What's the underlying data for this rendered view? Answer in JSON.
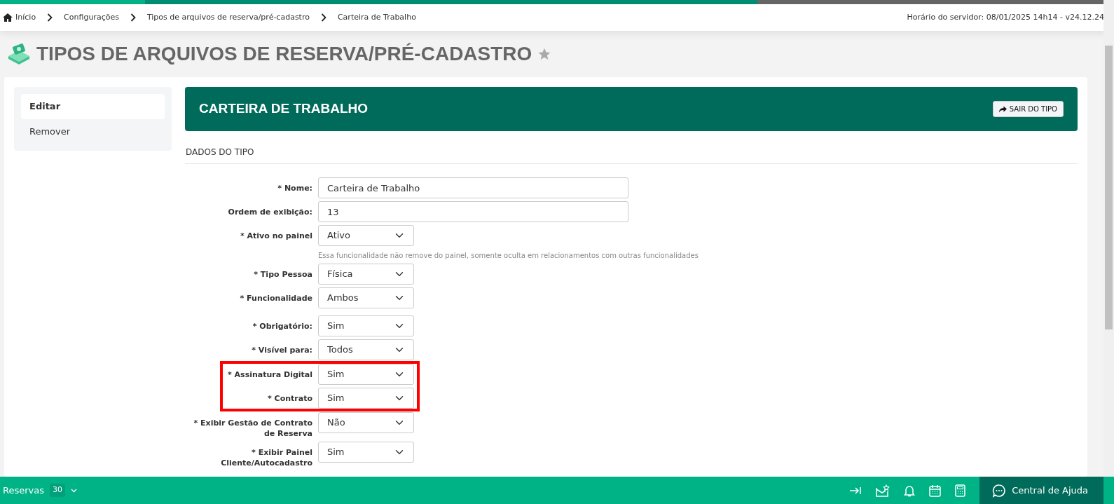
{
  "breadcrumb": [
    {
      "label": "Início",
      "kind": "home"
    },
    {
      "label": "Configurações",
      "kind": "link"
    },
    {
      "label": "Tipos de arquivos de reserva/pré-cadastro",
      "kind": "link"
    },
    {
      "label": "Carteira de Trabalho",
      "kind": "current"
    }
  ],
  "server_time": "Horário do servidor: 08/01/2025 14h14 - v24.12.24",
  "page_title": "TIPOS DE ARQUIVOS DE RESERVA/PRÉ-CADASTRO",
  "sidebar": {
    "items": [
      {
        "label": "Editar",
        "selected": true
      },
      {
        "label": "Remover",
        "selected": false
      }
    ]
  },
  "header": {
    "title": "CARTEIRA DE TRABALHO",
    "button": "SAIR DO TIPO"
  },
  "section_title": "DADOS DO TIPO",
  "fields": [
    {
      "label": "* Nome:",
      "kind": "text",
      "value": "Carteira de Trabalho",
      "highlighted": false
    },
    {
      "label": "Ordem de exibição:",
      "kind": "text",
      "value": "13",
      "highlighted": false
    },
    {
      "label": "* Ativo no painel",
      "kind": "select",
      "value": "Ativo",
      "hint": "Essa funcionalidade não remove do painel, somente oculta em relacionamentos com outras funcionalidades",
      "highlighted": false
    },
    {
      "label": "* Tipo Pessoa",
      "kind": "select",
      "value": "Física",
      "highlighted": false
    },
    {
      "label": "* Funcionalidade",
      "kind": "select",
      "value": "Ambos",
      "highlighted": false
    },
    {
      "label": "* Obrigatório:",
      "kind": "select",
      "value": "Sim",
      "highlighted": false
    },
    {
      "label": "* Visível para:",
      "kind": "select",
      "value": "Todos",
      "highlighted": false
    },
    {
      "label": "* Assinatura Digital",
      "kind": "select",
      "value": "Sim",
      "highlighted": true
    },
    {
      "label": "* Contrato",
      "kind": "select",
      "value": "Sim",
      "highlighted": true
    },
    {
      "label": "* Exibir Gestão de Contrato de Reserva",
      "kind": "select",
      "value": "Não",
      "highlighted": false
    },
    {
      "label": "* Exibir Painel Cliente/Autocadastro",
      "kind": "select",
      "value": "Sim",
      "highlighted": false
    }
  ],
  "bottom_bar": {
    "label": "Reservas",
    "count": "30",
    "help": "Central de Ajuda"
  }
}
